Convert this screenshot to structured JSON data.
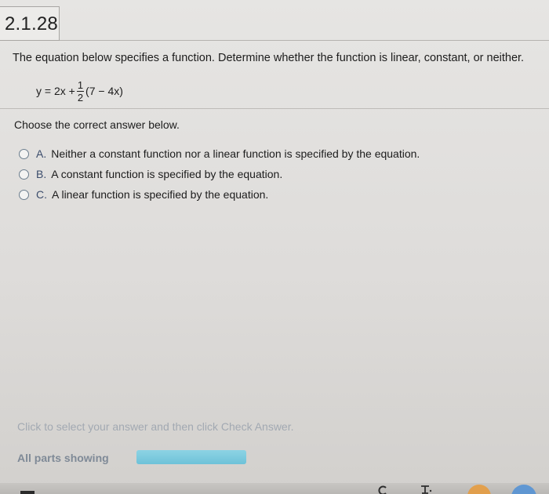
{
  "header": {
    "problem_id": "2.1.28"
  },
  "question": {
    "prompt": "The equation below specifies a function. Determine whether the function is linear, constant, or neither.",
    "equation": {
      "lhs": "y = 2x +",
      "fraction_numerator": "1",
      "fraction_denominator": "2",
      "rhs": "(7 − 4x)"
    }
  },
  "instruction": "Choose the correct answer below.",
  "options": [
    {
      "letter": "A.",
      "text": "Neither a constant function nor a linear function is specified by the equation."
    },
    {
      "letter": "B.",
      "text": "A constant function is specified by the equation."
    },
    {
      "letter": "C.",
      "text": "A linear function is specified by the equation."
    }
  ],
  "footer": {
    "hint": "Click to select your answer and then click Check Answer.",
    "all_parts_label": "All parts showing",
    "progress_fraction": 1.0
  },
  "colors": {
    "option_letter": "#3c4d6c",
    "hint_text": "#a2a9b2",
    "progress_fill": "#6ec2d8"
  },
  "icons": {
    "reload": "reload-icon",
    "tool": "tool-icon"
  }
}
